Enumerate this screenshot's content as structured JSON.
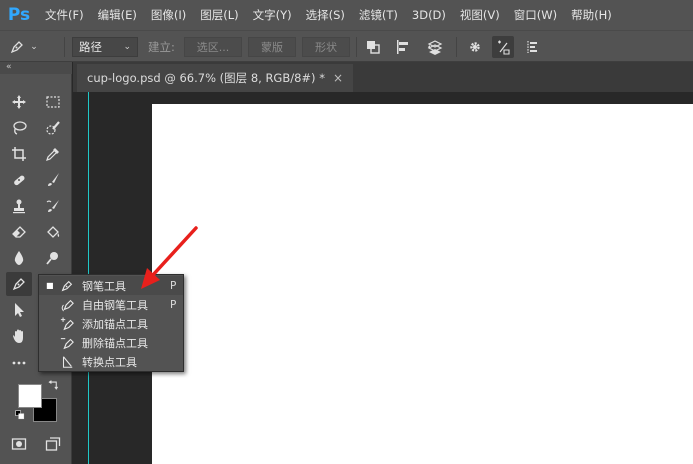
{
  "app": {
    "logo": "Ps"
  },
  "menu": [
    "文件(F)",
    "编辑(E)",
    "图像(I)",
    "图层(L)",
    "文字(Y)",
    "选择(S)",
    "滤镜(T)",
    "3D(D)",
    "视图(V)",
    "窗口(W)",
    "帮助(H)"
  ],
  "options": {
    "tool_icon": "pen-icon",
    "mode_value": "路径",
    "make_label": "建立:",
    "selection_label": "选区...",
    "mask_label": "蒙版",
    "shape_label": "形状"
  },
  "toolbox": {
    "grip": "«"
  },
  "document": {
    "tab_title": "cup-logo.psd @ 66.7% (图层 8, RGB/8#) *",
    "close": "×"
  },
  "flyout": {
    "items": [
      {
        "label": "钢笔工具",
        "shortcut": "P",
        "selected": true,
        "icon": "pen-icon"
      },
      {
        "label": "自由钢笔工具",
        "shortcut": "P",
        "selected": false,
        "icon": "freeform-pen-icon"
      },
      {
        "label": "添加锚点工具",
        "shortcut": "",
        "selected": false,
        "icon": "add-anchor-point-icon"
      },
      {
        "label": "删除锚点工具",
        "shortcut": "",
        "selected": false,
        "icon": "delete-anchor-point-icon"
      },
      {
        "label": "转换点工具",
        "shortcut": "",
        "selected": false,
        "icon": "convert-point-icon"
      }
    ],
    "bullet": "■"
  },
  "colors": {
    "accent_logo": "#31a8ff",
    "guide": "#1fc7c7",
    "annotation_arrow": "#e8201c",
    "foreground": "#ffffff",
    "background": "#000000"
  }
}
